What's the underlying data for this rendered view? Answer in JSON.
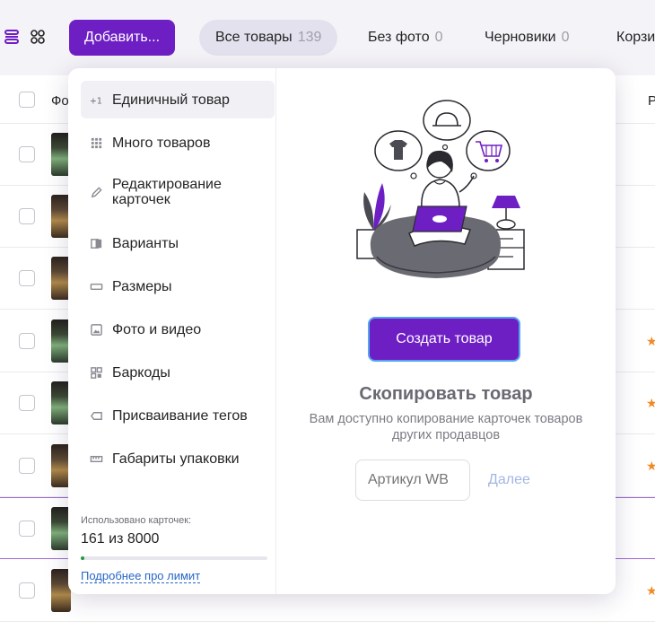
{
  "toolbar": {
    "add_button": "Добавить...",
    "tabs": [
      {
        "label": "Все товары",
        "count": "139"
      },
      {
        "label": "Без фото",
        "count": "0"
      },
      {
        "label": "Черновики",
        "count": "0"
      },
      {
        "label": "Корзи",
        "count": ""
      }
    ]
  },
  "table": {
    "header_photo": "Фо",
    "header_right": "Р"
  },
  "dropdown": {
    "menu_items": [
      {
        "icon": "plus-one-icon",
        "label": "Единичный товар"
      },
      {
        "icon": "grid-icon",
        "label": "Много товаров"
      },
      {
        "icon": "pencil-icon",
        "label": "Редактирование карточек"
      },
      {
        "icon": "variants-icon",
        "label": "Варианты"
      },
      {
        "icon": "ruler-icon",
        "label": "Размеры"
      },
      {
        "icon": "image-icon",
        "label": "Фото и видео"
      },
      {
        "icon": "qr-icon",
        "label": "Баркоды"
      },
      {
        "icon": "tag-icon",
        "label": "Присваивание тегов"
      },
      {
        "icon": "measure-icon",
        "label": "Габариты упаковки"
      }
    ],
    "usage_label": "Использовано карточек:",
    "usage_value": "161 из 8000",
    "usage_used": 161,
    "usage_total": 8000,
    "limit_link": "Подробнее про лимит",
    "create_button": "Создать товар",
    "copy_title": "Скопировать товар",
    "copy_desc": "Вам доступно копирование карточек товаров других продавцов",
    "article_placeholder": "Артикул WB",
    "next_link": "Далее"
  },
  "colors": {
    "accent": "#6e1fc4",
    "progress": "#1f9a3c",
    "link": "#2566c9",
    "star": "#f08a24"
  }
}
